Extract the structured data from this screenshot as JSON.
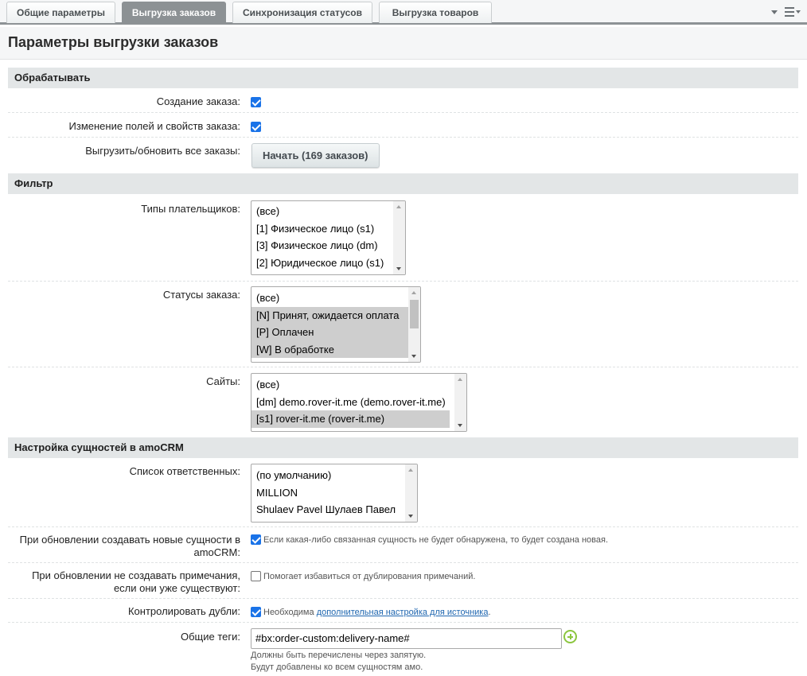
{
  "tabs": [
    {
      "label": "Общие параметры",
      "active": false
    },
    {
      "label": "Выгрузка заказов",
      "active": true
    },
    {
      "label": "Синхронизация статусов",
      "active": false
    },
    {
      "label": "Выгрузка товаров",
      "active": false
    }
  ],
  "page_title": "Параметры выгрузки заказов",
  "sections": {
    "process": "Обрабатывать",
    "filter": "Фильтр",
    "amocrm": "Настройка сущностей в amoCRM"
  },
  "process": {
    "create_label": "Создание заказа:",
    "create_checked": true,
    "change_label": "Изменение полей и свойств заказа:",
    "change_checked": true,
    "export_label": "Выгрузить/обновить все заказы:",
    "start_button": "Начать (169 заказов)"
  },
  "filter": {
    "payer_types_label": "Типы плательщиков:",
    "payer_types": [
      {
        "text": "(все)",
        "selected": false
      },
      {
        "text": "[1] Физическое лицо (s1)",
        "selected": false
      },
      {
        "text": "[3] Физическое лицо (dm)",
        "selected": false
      },
      {
        "text": "[2] Юридическое лицо (s1)",
        "selected": false
      }
    ],
    "statuses_label": "Статусы заказа:",
    "statuses": [
      {
        "text": "(все)",
        "selected": false
      },
      {
        "text": "[N] Принят, ожидается оплата",
        "selected": true
      },
      {
        "text": "[P] Оплачен",
        "selected": true
      },
      {
        "text": "[W] В обработке",
        "selected": true
      }
    ],
    "sites_label": "Сайты:",
    "sites": [
      {
        "text": "(все)",
        "selected": false
      },
      {
        "text": "[dm] demo.rover-it.me (demo.rover-it.me)",
        "selected": false
      },
      {
        "text": "[s1] rover-it.me (rover-it.me)",
        "selected": true
      }
    ]
  },
  "amocrm": {
    "responsible_label": "Список ответственных:",
    "responsible": [
      {
        "text": "(по умолчанию)",
        "selected": false
      },
      {
        "text": "MILLION",
        "selected": false
      },
      {
        "text": "Shulaev Pavel Шулаев Павел",
        "selected": false
      }
    ],
    "create_new_label_1": "При обновлении создавать новые сущности в",
    "create_new_label_2": "amoCRM:",
    "create_new_checked": true,
    "create_new_hint": "Если какая-либо связанная сущность не будет обнаружена, то будет создана новая.",
    "no_notes_label_1": "При обновлении не создавать примечания,",
    "no_notes_label_2": "если они уже существуют:",
    "no_notes_checked": false,
    "no_notes_hint": "Помогает избавиться от дублирования примечаний.",
    "duplicates_label": "Контролировать дубли:",
    "duplicates_checked": true,
    "duplicates_hint_prefix": "Необходима",
    "duplicates_hint_link": "дополнительная настройка для источника",
    "duplicates_hint_suffix": ".",
    "tags_label": "Общие теги:",
    "tags_value": "#bx:order-custom:delivery-name#",
    "tags_note_1": "Должны быть перечислены через запятую.",
    "tags_note_2": "Будут добавлены ко всем сущностям амо."
  }
}
